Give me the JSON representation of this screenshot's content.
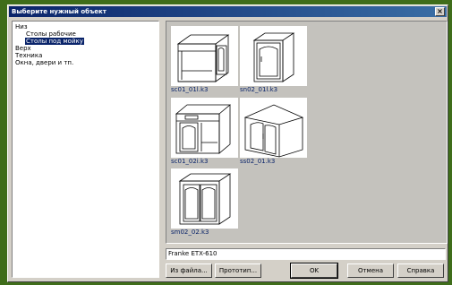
{
  "window": {
    "title": "Выберите нужный объект"
  },
  "tree": {
    "items": [
      {
        "label": "Низ",
        "level": 0,
        "selected": false
      },
      {
        "label": "Столы рабочие",
        "level": 1,
        "selected": false
      },
      {
        "label": "Столы под мойку",
        "level": 1,
        "selected": true
      },
      {
        "label": "Верх",
        "level": 0,
        "selected": false
      },
      {
        "label": "Техника",
        "level": 0,
        "selected": false
      },
      {
        "label": "Окна, двери и тп.",
        "level": 0,
        "selected": false
      }
    ]
  },
  "gallery": {
    "items": [
      {
        "caption": "sc01_01l.k3",
        "icon": "cabinet-open-drawer"
      },
      {
        "caption": "sn02_01l.k3",
        "icon": "cabinet-single-door"
      },
      {
        "caption": "sc01_02i.k3",
        "icon": "cabinet-drawer-door-open"
      },
      {
        "caption": "ss02_01.k3",
        "icon": "corner-cabinet"
      },
      {
        "caption": "sm02_02.k3",
        "icon": "cabinet-double-door"
      }
    ]
  },
  "object_name": {
    "value": "Franke ETX-610"
  },
  "buttons": {
    "from_file": "Из файла...",
    "prototype": "Прототип...",
    "ok": "OK",
    "cancel": "Отмена",
    "help": "Справка"
  },
  "close_symbol": "×"
}
